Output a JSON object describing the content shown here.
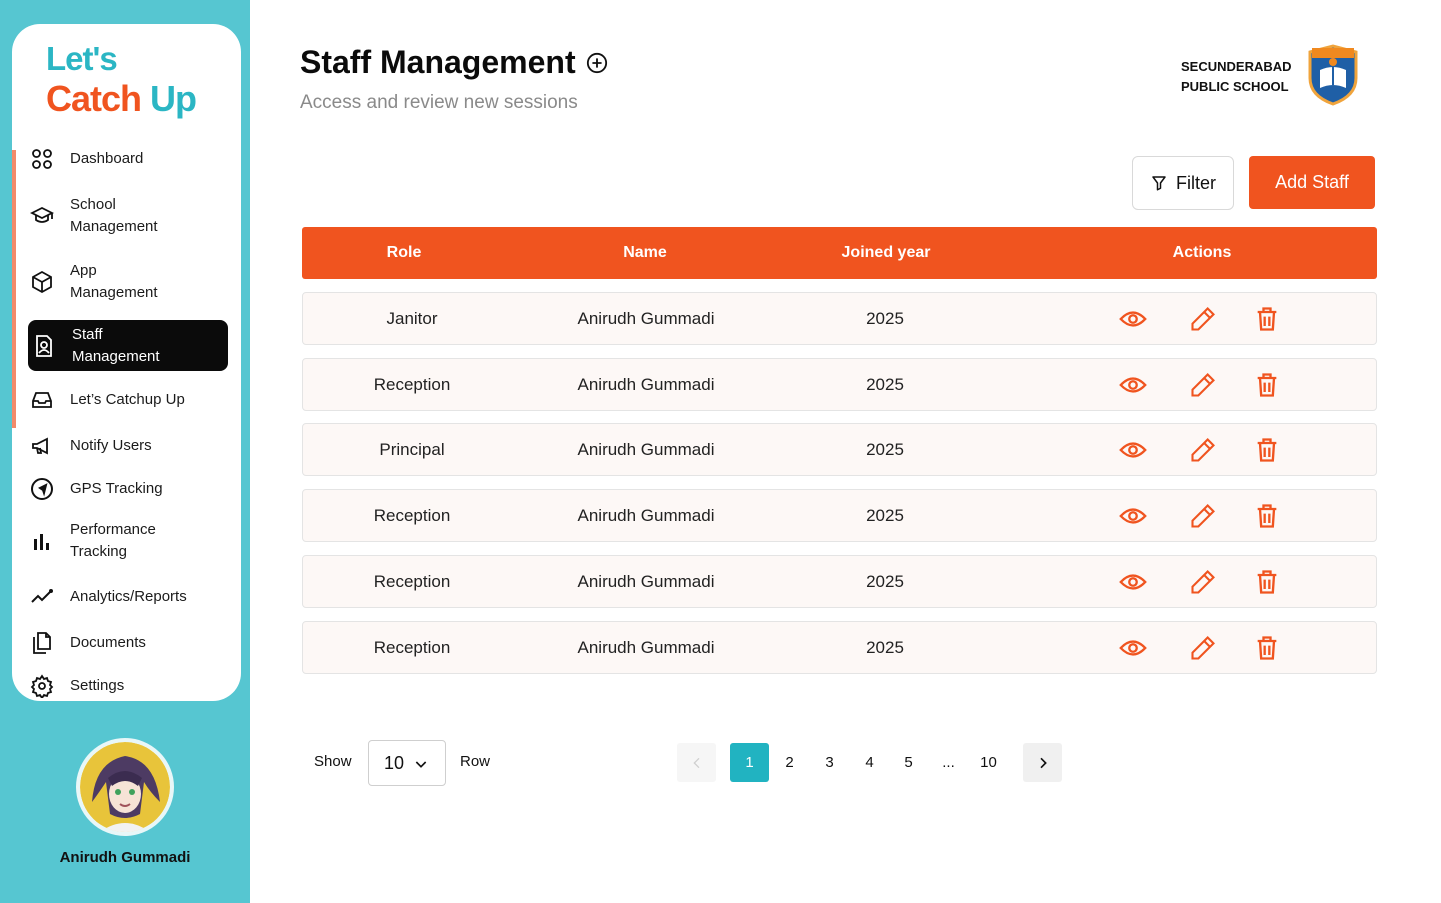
{
  "brand": {
    "line1": "Let's",
    "line2_a": "Catch ",
    "line2_b": "Up"
  },
  "sidebar": {
    "items": [
      {
        "label": "Dashboard",
        "icon": "dashboard-grid-icon"
      },
      {
        "label": "School\nManagement",
        "icon": "graduation-cap-icon"
      },
      {
        "label": "App\nManagement",
        "icon": "cube-icon"
      },
      {
        "label": "Staff\nManagement",
        "icon": "staff-badge-icon",
        "active": true
      },
      {
        "label": "Let’s Catchup Up",
        "icon": "inbox-icon"
      },
      {
        "label": "Notify Users",
        "icon": "megaphone-icon"
      },
      {
        "label": "GPS Tracking",
        "icon": "navigation-icon"
      },
      {
        "label": "Performance\nTracking",
        "icon": "bar-chart-icon"
      },
      {
        "label": "Analytics/Reports",
        "icon": "trend-line-icon"
      },
      {
        "label": "Documents",
        "icon": "documents-icon"
      },
      {
        "label": "Settings",
        "icon": "gear-icon"
      }
    ]
  },
  "user": {
    "name": "Anirudh Gummadi"
  },
  "header": {
    "title": "Staff Management",
    "subtitle": "Access and review new sessions",
    "school_line1": "SECUNDERABAD",
    "school_line2": "PUBLIC SCHOOL"
  },
  "toolbar": {
    "filter_label": "Filter",
    "add_label": "Add Staff"
  },
  "table": {
    "columns": [
      "Role",
      "Name",
      "Joined year",
      "Actions"
    ],
    "rows": [
      {
        "role": "Janitor",
        "name": "Anirudh Gummadi",
        "year": "2025"
      },
      {
        "role": "Reception",
        "name": "Anirudh Gummadi",
        "year": "2025"
      },
      {
        "role": "Principal",
        "name": "Anirudh Gummadi",
        "year": "2025"
      },
      {
        "role": "Reception",
        "name": "Anirudh Gummadi",
        "year": "2025"
      },
      {
        "role": "Reception",
        "name": "Anirudh Gummadi",
        "year": "2025"
      },
      {
        "role": "Reception",
        "name": "Anirudh Gummadi",
        "year": "2025"
      }
    ]
  },
  "pagination": {
    "show_label": "Show",
    "rows_value": "10",
    "row_label": "Row",
    "pages": [
      "1",
      "2",
      "3",
      "4",
      "5",
      "...",
      "10"
    ],
    "current": "1"
  },
  "colors": {
    "accent": "#f0541f",
    "teal": "#56c6d1",
    "page_active": "#21b3c1"
  }
}
